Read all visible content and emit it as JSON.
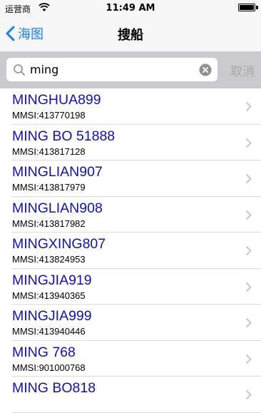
{
  "status_bar": {
    "carrier": "运营商",
    "time": "11:49 AM",
    "wifi_icon": "wifi-icon",
    "battery_level": 1.0
  },
  "nav": {
    "back_label": "海图",
    "title": "搜船",
    "back_icon": "chevron-left-icon",
    "accent_color": "#1a7af8"
  },
  "search": {
    "value": "ming",
    "placeholder": "",
    "cancel_label": "取消",
    "search_icon": "magnifier-icon",
    "clear_icon": "clear-circle-icon"
  },
  "list": {
    "mmsi_prefix": "MMSI:",
    "name_color": "#1010b8",
    "items": [
      {
        "name": "MINGHUA899",
        "mmsi": "413770198"
      },
      {
        "name": "MING BO 51888",
        "mmsi": "413817128"
      },
      {
        "name": "MINGLIAN907",
        "mmsi": "413817979"
      },
      {
        "name": "MINGLIAN908",
        "mmsi": "413817982"
      },
      {
        "name": "MINGXING807",
        "mmsi": "413824953"
      },
      {
        "name": "MINGJIA919",
        "mmsi": "413940365"
      },
      {
        "name": "MINGJIA999",
        "mmsi": "413940446"
      },
      {
        "name": "MING 768",
        "mmsi": "901000768"
      },
      {
        "name": "MING BO818",
        "mmsi": ""
      }
    ]
  }
}
